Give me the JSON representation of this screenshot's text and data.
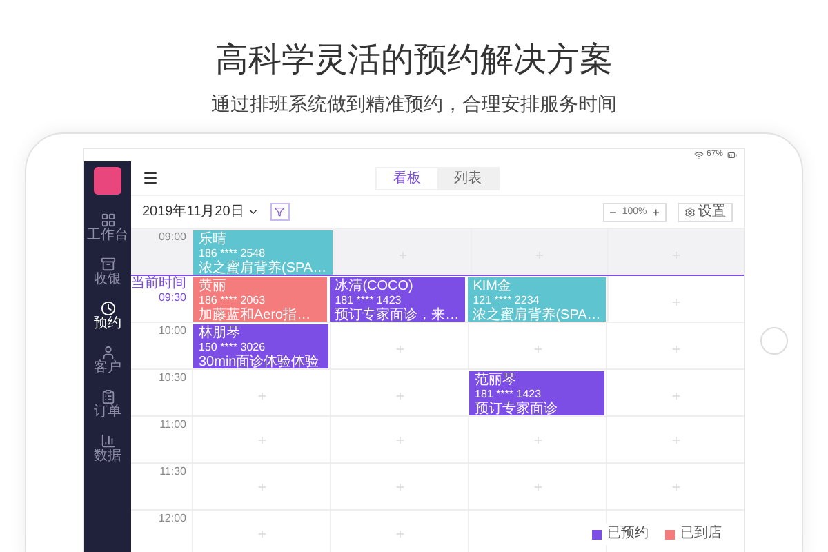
{
  "headline": "高科学灵活的预约解决方案",
  "subheadline": "通过排班系统做到精准预约，合理安排服务时间",
  "status_bar": {
    "battery": "67%"
  },
  "sidebar": {
    "items": [
      {
        "label": "工作台",
        "selected": false
      },
      {
        "label": "收银",
        "selected": false
      },
      {
        "label": "预约",
        "selected": true
      },
      {
        "label": "客户",
        "selected": false
      },
      {
        "label": "订单",
        "selected": false
      },
      {
        "label": "数据",
        "selected": false
      }
    ]
  },
  "view_tabs": [
    {
      "label": "看板",
      "selected": true
    },
    {
      "label": "列表",
      "selected": false
    }
  ],
  "toolbar": {
    "date": "2019年11月20日",
    "zoom": "100%",
    "zoom_out": "−",
    "zoom_in": "+",
    "settings": "设置"
  },
  "schedule": {
    "rows": [
      {
        "time": "09:00",
        "past": true,
        "current_label": "",
        "cells": [
          {
            "kind": "appointment",
            "name": "乐晴",
            "phone": "186 **** 2548",
            "service": "浓之蜜肩背养(SPA…",
            "color": "#5ec4cf"
          },
          {
            "kind": "empty"
          },
          {
            "kind": "empty"
          },
          {
            "kind": "empty"
          }
        ]
      },
      {
        "time": "09:30",
        "past": false,
        "current_label": "当前时间",
        "cells": [
          {
            "kind": "appointment",
            "name": "黄丽",
            "phone": "186 **** 2063",
            "service": "加藤蓝和Aero指…",
            "color": "#f47c7c"
          },
          {
            "kind": "appointment",
            "name": "冰清(COCO)",
            "phone": "181 **** 1423",
            "service": "预订专家面诊，来…",
            "color": "#7d4ee6"
          },
          {
            "kind": "appointment",
            "name": "KIM金",
            "phone": "121 **** 2234",
            "service": "浓之蜜肩背养(SPA…",
            "color": "#5ec4cf"
          },
          {
            "kind": "empty"
          }
        ]
      },
      {
        "time": "10:00",
        "past": false,
        "current_label": "",
        "cells": [
          {
            "kind": "appointment",
            "name": "林朋琴",
            "phone": "150 **** 3026",
            "service": "30min面诊体验体验",
            "color": "#7d4ee6"
          },
          {
            "kind": "empty"
          },
          {
            "kind": "empty"
          },
          {
            "kind": "empty"
          }
        ]
      },
      {
        "time": "10:30",
        "past": false,
        "current_label": "",
        "cells": [
          {
            "kind": "empty"
          },
          {
            "kind": "empty"
          },
          {
            "kind": "appointment",
            "name": "范丽琴",
            "phone": "181 **** 1423",
            "service": "预订专家面诊",
            "color": "#7d4ee6"
          },
          {
            "kind": "empty"
          }
        ]
      },
      {
        "time": "11:00",
        "past": false,
        "current_label": "",
        "cells": [
          {
            "kind": "empty"
          },
          {
            "kind": "empty"
          },
          {
            "kind": "empty"
          },
          {
            "kind": "empty"
          }
        ]
      },
      {
        "time": "11:30",
        "past": false,
        "current_label": "",
        "cells": [
          {
            "kind": "empty"
          },
          {
            "kind": "empty"
          },
          {
            "kind": "empty"
          },
          {
            "kind": "empty"
          }
        ]
      },
      {
        "time": "12:00",
        "past": false,
        "current_label": "",
        "cells": [
          {
            "kind": "empty"
          },
          {
            "kind": "empty"
          },
          {
            "kind": "blank"
          },
          {
            "kind": "blank"
          }
        ]
      }
    ]
  },
  "legend": [
    {
      "label": "已预约",
      "color": "#7d4ee6"
    },
    {
      "label": "已到店",
      "color": "#f47c7c"
    }
  ]
}
